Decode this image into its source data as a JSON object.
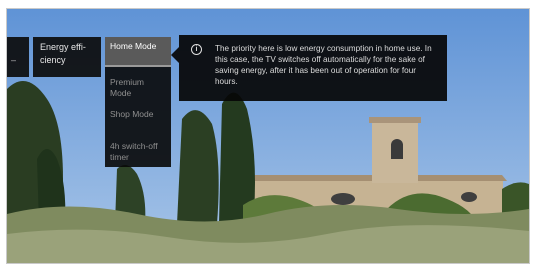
{
  "breadcrumb": {
    "current_label": "Energy effi-ciency"
  },
  "menu": {
    "items": [
      {
        "label": "Home Mode",
        "selected": true
      },
      {
        "label": "Premium Mode",
        "selected": false
      },
      {
        "label": "Shop Mode",
        "selected": false
      },
      {
        "label": "4h switch-off timer",
        "selected": false
      }
    ]
  },
  "info": {
    "icon": "info-icon",
    "text": "The priority here is low energy consumption in home use. In this case, the TV switches off automatically for the sake of saving energy, after it has been out of operation for four hours."
  },
  "colors": {
    "sky": "#6f9ed8",
    "panel_bg": "#0c0c0c",
    "selected_bg": "#5a5a5a",
    "church_wall": "#c8b59a"
  }
}
